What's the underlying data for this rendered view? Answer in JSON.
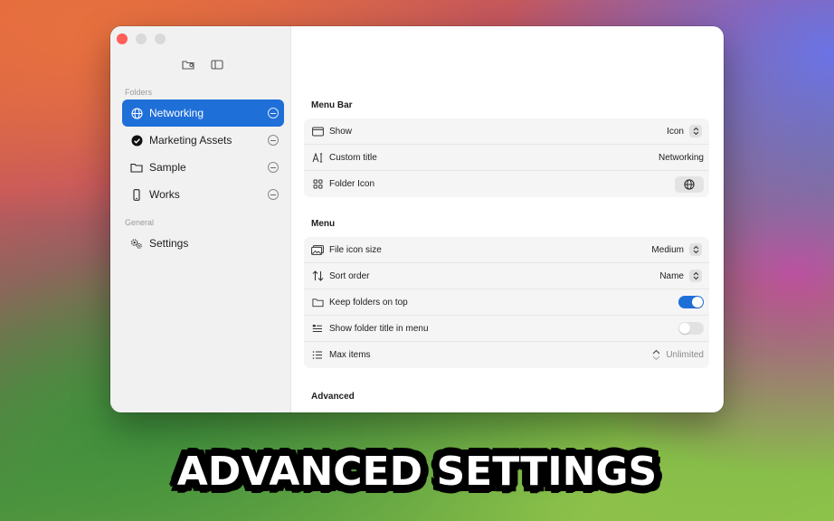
{
  "sidebar": {
    "folders_label": "Folders",
    "general_label": "General",
    "items": [
      {
        "label": "Networking",
        "icon": "globe-icon"
      },
      {
        "label": "Marketing Assets",
        "icon": "checkmark-circle-icon"
      },
      {
        "label": "Sample",
        "icon": "folder-icon"
      },
      {
        "label": "Works",
        "icon": "phone-icon"
      }
    ],
    "settings_label": "Settings"
  },
  "menu_bar": {
    "title": "Menu Bar",
    "rows": [
      {
        "label": "Show",
        "value": "Icon"
      },
      {
        "label": "Custom title",
        "value": "Networking"
      },
      {
        "label": "Folder Icon"
      }
    ]
  },
  "menu": {
    "title": "Menu",
    "rows": [
      {
        "label": "File icon size",
        "value": "Medium"
      },
      {
        "label": "Sort order",
        "value": "Name"
      },
      {
        "label": "Keep folders on top",
        "enabled": true
      },
      {
        "label": "Show folder title in menu",
        "enabled": false
      },
      {
        "label": "Max items",
        "value": "Unlimited"
      }
    ]
  },
  "advanced": {
    "title": "Advanced"
  },
  "headline": "ADVANCED SETTINGS",
  "colors": {
    "accent": "#1f6fd9",
    "close": "#fe5f57"
  }
}
